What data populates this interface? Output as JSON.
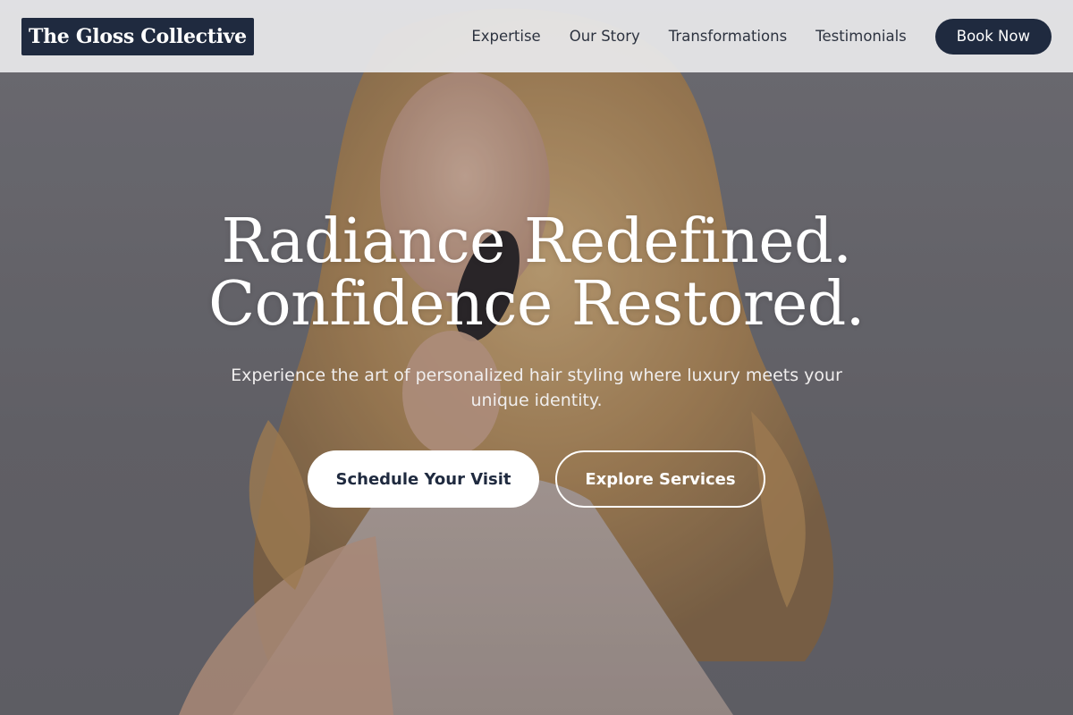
{
  "header": {
    "logo_text": "The Gloss Collective",
    "nav": [
      {
        "label": "Expertise"
      },
      {
        "label": "Our Story"
      },
      {
        "label": "Transformations"
      },
      {
        "label": "Testimonials"
      }
    ],
    "book_label": "Book Now"
  },
  "hero": {
    "title_line1": "Radiance Redefined.",
    "title_line2": "Confidence Restored.",
    "subtitle": "Experience the art of personalized hair styling where luxury meets your unique identity.",
    "primary_cta": "Schedule Your Visit",
    "secondary_cta": "Explore Services",
    "image_description_icon": "hero-photo-woman-brushing-hair"
  },
  "colors": {
    "brand_navy": "#1f2a3f",
    "header_bg": "#e8e8ea",
    "text_light": "#ffffff",
    "hair_gold": "#c9a26a"
  }
}
